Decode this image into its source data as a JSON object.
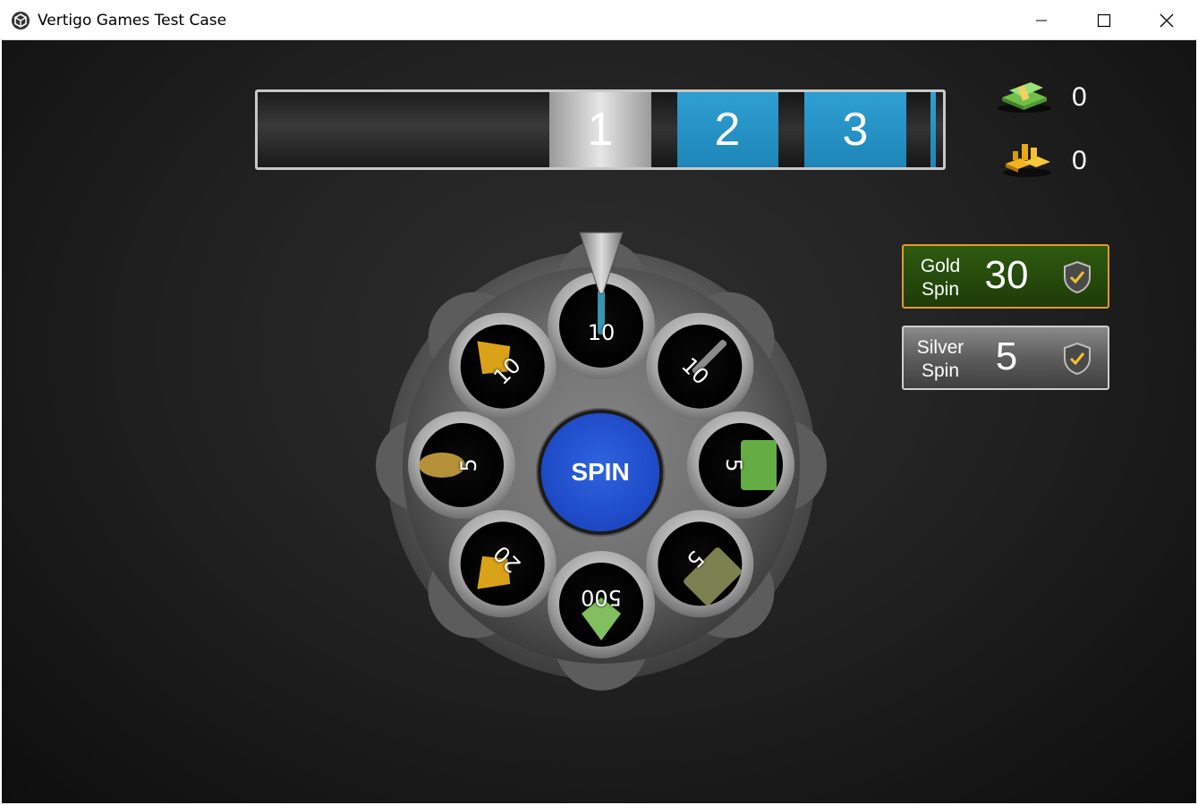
{
  "window": {
    "title": "Vertigo Games Test Case",
    "minimize_glyph": "—",
    "maximize_glyph": "☐",
    "close_glyph": "✕"
  },
  "stages": [
    {
      "label": "1",
      "state": "current"
    },
    {
      "label": "2",
      "state": "upcoming"
    },
    {
      "label": "3",
      "state": "upcoming"
    }
  ],
  "currencies": {
    "cash": {
      "icon": "cash-stack-icon",
      "value": "0"
    },
    "gold": {
      "icon": "gold-bars-icon",
      "value": "0"
    }
  },
  "spin_buttons": {
    "gold": {
      "label_line1": "Gold",
      "label_line2": "Spin",
      "count": "30",
      "icon": "shield-check-icon",
      "color": "#2f5a10",
      "border": "#e39a21"
    },
    "silver": {
      "label_line1": "Silver",
      "label_line2": "Spin",
      "count": "5",
      "icon": "shield-check-icon",
      "color": "#6a6a6a",
      "border": "#cfcfcf"
    }
  },
  "wheel": {
    "center_label": "SPIN",
    "slots": [
      {
        "item": "knife",
        "icon": "knife-icon",
        "amount": "10"
      },
      {
        "item": "rifle",
        "icon": "rifle-icon",
        "amount": "10"
      },
      {
        "item": "ammo crate",
        "icon": "ammo-crate-icon",
        "amount": "5"
      },
      {
        "item": "backpack",
        "icon": "backpack-icon",
        "amount": "5"
      },
      {
        "item": "cash",
        "icon": "cash-stack-icon",
        "amount": "500"
      },
      {
        "item": "gold",
        "icon": "gold-bars-icon",
        "amount": "20"
      },
      {
        "item": "grenade",
        "icon": "grenade-icon",
        "amount": "5"
      },
      {
        "item": "gold",
        "icon": "gold-bars-icon",
        "amount": "10"
      }
    ]
  },
  "colors": {
    "accent_blue": "#1e86b8",
    "spin_blue": "#1d48c4"
  }
}
